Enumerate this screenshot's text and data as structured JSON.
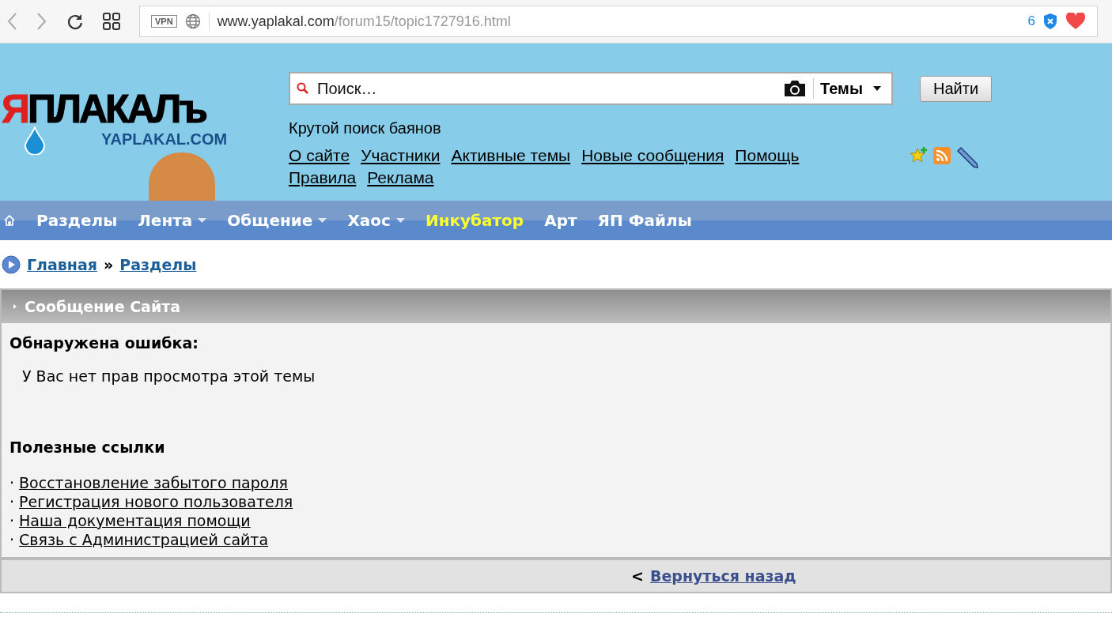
{
  "browser": {
    "url_host": "www.yaplakal.com",
    "url_path": "/forum15/topic1727916.html",
    "vpn_label": "VPN",
    "blocked_count": "6"
  },
  "logo": {
    "accent": "Я",
    "text": "ПЛАКАЛъ",
    "subtitle": "YAPLAKAL.COM"
  },
  "search": {
    "placeholder": "Поиск…",
    "scope": "Темы",
    "button": "Найти",
    "tagline": "Крутой поиск баянов"
  },
  "header_links": [
    "О сайте",
    "Участники",
    "Активные темы",
    "Новые сообщения",
    "Помощь",
    "Правила",
    "Реклама"
  ],
  "nav": [
    {
      "label": "Разделы",
      "dropdown": false,
      "highlighted": false
    },
    {
      "label": "Лента",
      "dropdown": true,
      "highlighted": false
    },
    {
      "label": "Общение",
      "dropdown": true,
      "highlighted": false
    },
    {
      "label": "Хаос",
      "dropdown": true,
      "highlighted": false
    },
    {
      "label": "Инкубатор",
      "dropdown": false,
      "highlighted": true
    },
    {
      "label": "Арт",
      "dropdown": false,
      "highlighted": false
    },
    {
      "label": "ЯП Файлы",
      "dropdown": false,
      "highlighted": false
    }
  ],
  "breadcrumb": {
    "items": [
      "Главная",
      "Разделы"
    ],
    "separator": "»"
  },
  "panel": {
    "title": "Сообщение Сайта",
    "error_heading": "Обнаружена ошибка:",
    "error_text": "У Вас нет прав просмотра этой темы",
    "links_heading": "Полезные ссылки",
    "bullet": "·",
    "links": [
      "Восстановление забытого пароля",
      "Регистрация нового пользователя",
      "Наша документация помощи",
      "Связь с Администрацией сайта"
    ],
    "back_prefix": "<",
    "back_link": "Вернуться назад"
  }
}
